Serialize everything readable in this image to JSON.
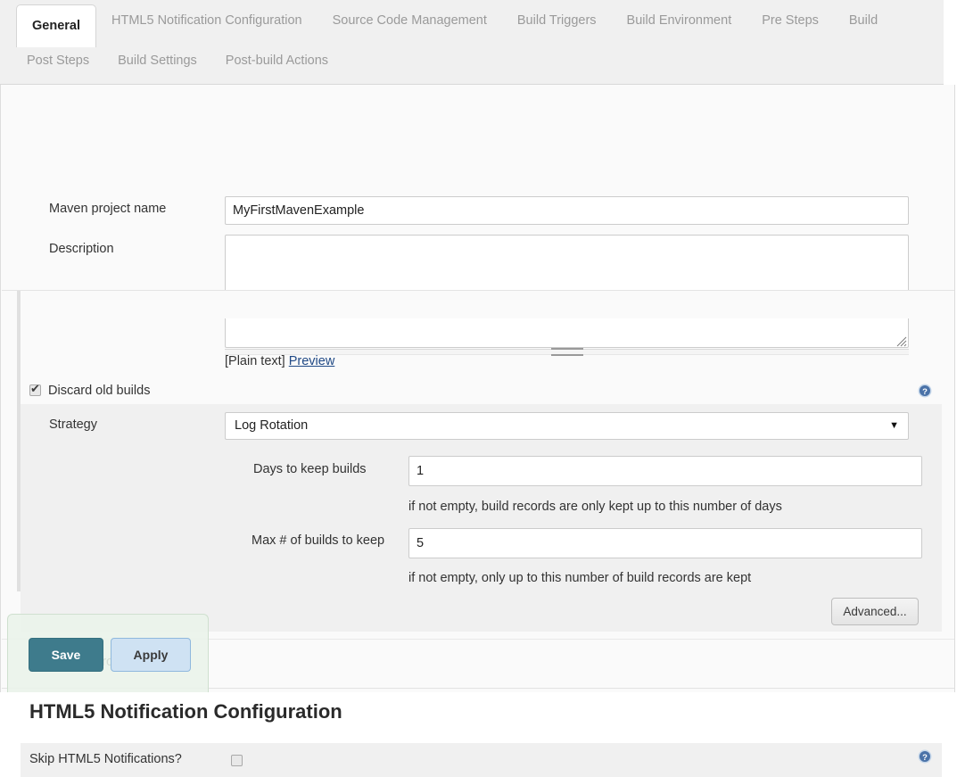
{
  "tabs": {
    "row1": [
      {
        "label": "General",
        "active": true
      },
      {
        "label": "HTML5 Notification Configuration",
        "active": false
      },
      {
        "label": "Source Code Management",
        "active": false
      },
      {
        "label": "Build Triggers",
        "active": false
      },
      {
        "label": "Build Environment",
        "active": false
      },
      {
        "label": "Pre Steps",
        "active": false
      },
      {
        "label": "Build",
        "active": false
      }
    ],
    "row2": [
      {
        "label": "Post Steps",
        "active": false
      },
      {
        "label": "Build Settings",
        "active": false
      },
      {
        "label": "Post-build Actions",
        "active": false
      }
    ]
  },
  "general": {
    "maven_project_name_label": "Maven project name",
    "maven_project_name_value": "MyFirstMavenExample",
    "description_label": "Description",
    "description_value": "",
    "plain_text_label": "[Plain text]",
    "preview_link": "Preview"
  },
  "discard_old_builds": {
    "label": "Discard old builds",
    "checked": true,
    "help_icon": "help-icon",
    "strategy_label": "Strategy",
    "strategy_value": "Log Rotation",
    "strategy_caret": "▼",
    "days_to_keep_label": "Days to keep builds",
    "days_to_keep_value": "1",
    "days_to_keep_hint": "if not empty, build records are only kept up to this number of days",
    "max_builds_label": "Max # of builds to keep",
    "max_builds_value": "5",
    "max_builds_hint": "if not empty, only up to this number of build records are kept",
    "advanced_button": "Advanced..."
  },
  "github_project": {
    "label": "GitHub project",
    "checked": false
  },
  "html5_section": {
    "heading": "HTML5 Notification Configuration",
    "skip_label": "Skip HTML5 Notifications?",
    "skip_checked": false,
    "help_icon": "help-icon"
  },
  "footer": {
    "save_label": "Save",
    "apply_label": "Apply"
  },
  "colors": {
    "save_button": "#3e7b8c",
    "apply_button": "#cfe2f3",
    "help_icon": "#4a72a8",
    "link": "#214a86",
    "panel": "#f0f0f0"
  }
}
